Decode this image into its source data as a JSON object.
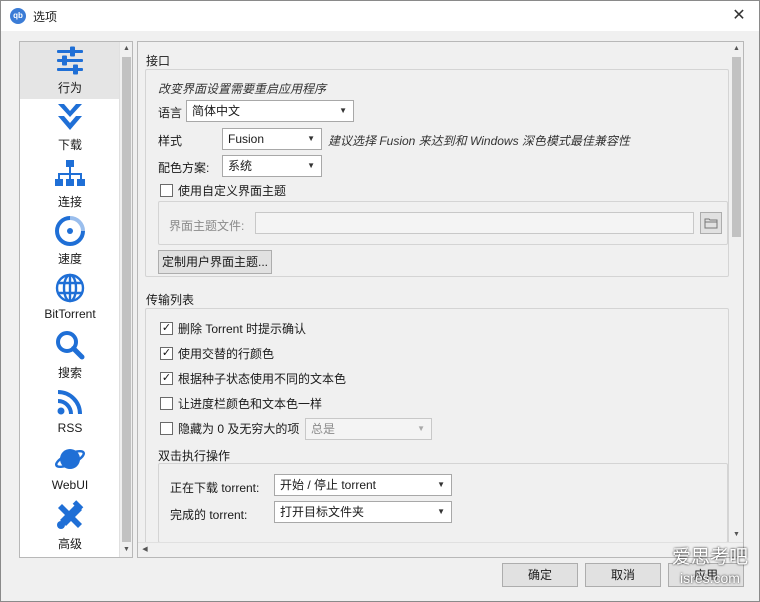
{
  "window": {
    "title": "选项",
    "app_icon_text": "qb",
    "close_glyph": "✕"
  },
  "sidebar": {
    "items": [
      {
        "label": "行为",
        "icon": "sliders-icon",
        "selected": true
      },
      {
        "label": "下载",
        "icon": "double-chevron-down-icon",
        "selected": false
      },
      {
        "label": "连接",
        "icon": "network-icon",
        "selected": false
      },
      {
        "label": "速度",
        "icon": "speedometer-icon",
        "selected": false
      },
      {
        "label": "BitTorrent",
        "icon": "globe-icon",
        "selected": false
      },
      {
        "label": "搜索",
        "icon": "search-icon",
        "selected": false
      },
      {
        "label": "RSS",
        "icon": "rss-icon",
        "selected": false
      },
      {
        "label": "WebUI",
        "icon": "planet-icon",
        "selected": false
      },
      {
        "label": "高级",
        "icon": "tools-icon",
        "selected": false
      }
    ]
  },
  "interface": {
    "group_title": "接口",
    "restart_note": "改变界面设置需要重启应用程序",
    "language_label": "语言",
    "language_value": "简体中文",
    "style_label": "样式",
    "style_value": "Fusion",
    "style_hint": "建议选择 Fusion 来达到和 Windows 深色模式最佳兼容性",
    "color_scheme_label": "配色方案:",
    "color_scheme_value": "系统",
    "custom_theme_checkbox": "使用自定义界面主题",
    "custom_theme_checked": false,
    "theme_file_label": "界面主题文件:",
    "theme_file_value": "",
    "customize_button": "定制用户界面主题..."
  },
  "transfer_list": {
    "group_title": "传输列表",
    "options": [
      {
        "label": "删除 Torrent 时提示确认",
        "checked": true
      },
      {
        "label": "使用交替的行颜色",
        "checked": true
      },
      {
        "label": "根据种子状态使用不同的文本色",
        "checked": true
      },
      {
        "label": "让进度栏颜色和文本色一样",
        "checked": false
      }
    ],
    "hide_zero_label": "隐藏为 0 及无穷大的项",
    "hide_zero_checked": false,
    "hide_zero_value": "总是",
    "double_click_title": "双击执行操作",
    "downloading_label": "正在下载 torrent:",
    "downloading_value": "开始 / 停止 torrent",
    "completed_label": "完成的 torrent:",
    "completed_value": "打开目标文件夹"
  },
  "footer": {
    "ok_label": "确定",
    "cancel_label": "取消",
    "apply_label": "应用"
  },
  "watermark": {
    "line1": "爱思考吧",
    "line2": "isres.com"
  },
  "colors": {
    "accent": "#1f6fd6",
    "window_bg": "#f0f0f0",
    "selected_item_bg": "#e5e5e5"
  }
}
